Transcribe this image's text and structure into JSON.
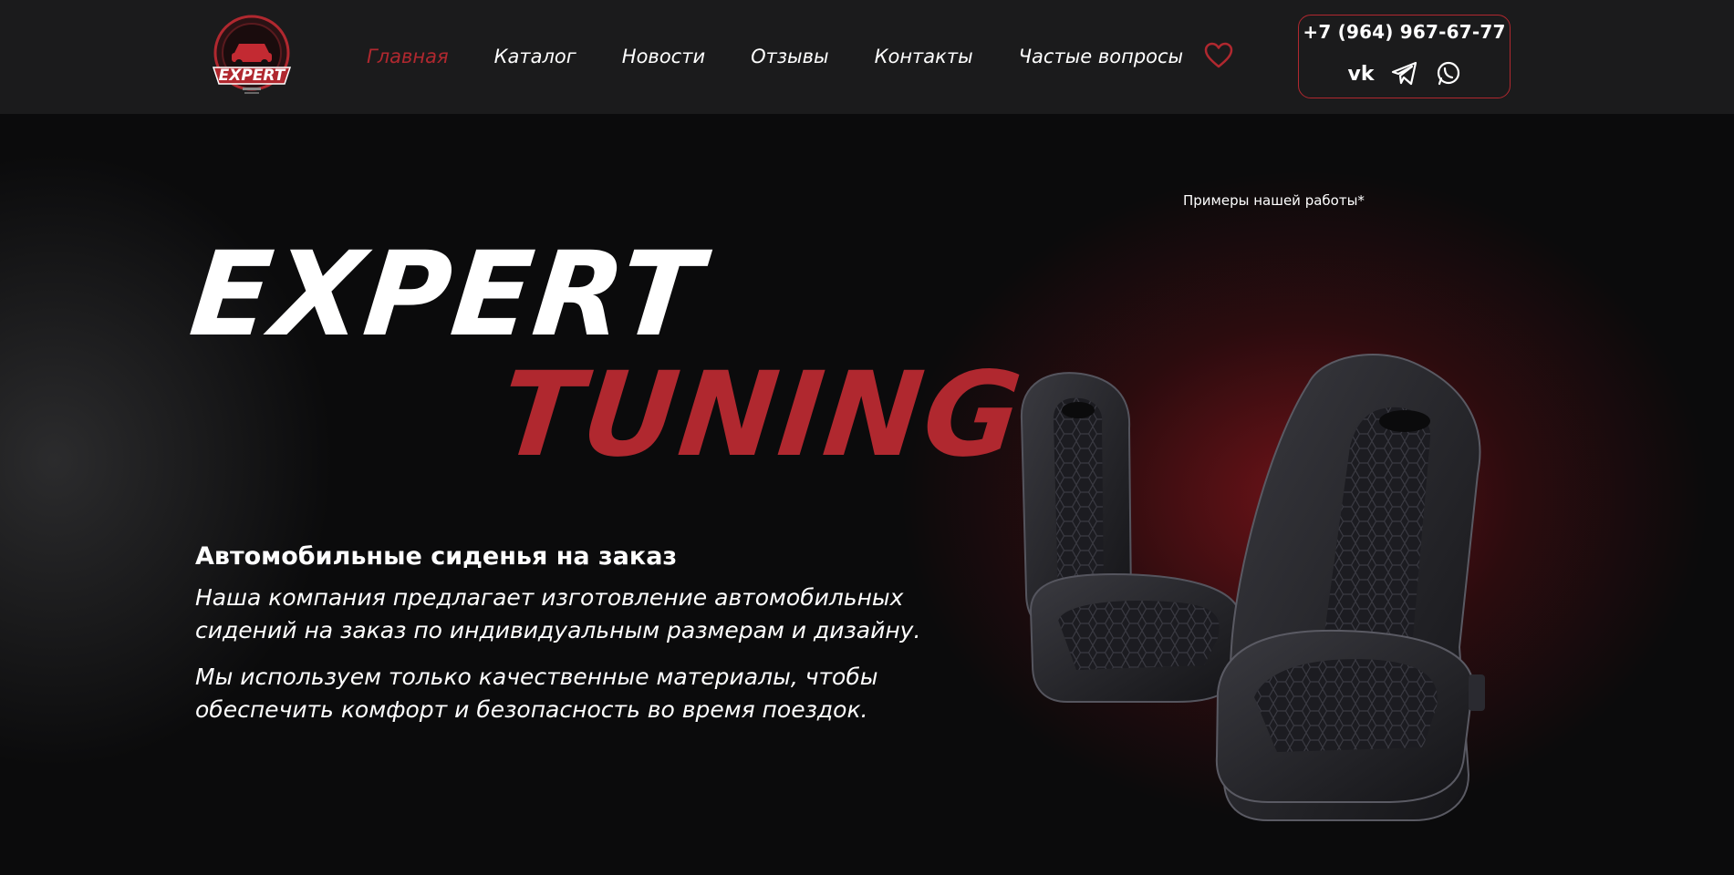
{
  "header": {
    "logo": {
      "icon": "expert-tuning-logo",
      "text": "EXPERT"
    },
    "nav": [
      {
        "label": "Главная",
        "active": true
      },
      {
        "label": "Каталог",
        "active": false
      },
      {
        "label": "Новости",
        "active": false
      },
      {
        "label": "Отзывы",
        "active": false
      },
      {
        "label": "Контакты",
        "active": false
      },
      {
        "label": "Частые вопросы",
        "active": false
      }
    ],
    "favorites_icon": "heart-icon",
    "contact": {
      "phone": "+7 (964) 967-67-77",
      "socials": [
        "vk-icon",
        "telegram-icon",
        "whatsapp-icon"
      ]
    }
  },
  "hero": {
    "examples_note": "Примеры нашей работы*",
    "title_line1": "EXPERT",
    "title_line2": "TUNING",
    "subtitle": "Автомобильные сиденья на заказ",
    "paragraph1_line1": "Наша компания предлагает изготовление автомобильных",
    "paragraph1_line2": "сидений на заказ по индивидуальным размерам и дизайну.",
    "paragraph2_line1": "Мы используем только качественные материалы, чтобы",
    "paragraph2_line2": "обеспечить комфорт и безопасность во время поездок.",
    "image": "car-seats-image"
  },
  "colors": {
    "accent": "#b0282f",
    "header_bg": "#1b1b1c",
    "page_bg": "#0b0b0c"
  }
}
